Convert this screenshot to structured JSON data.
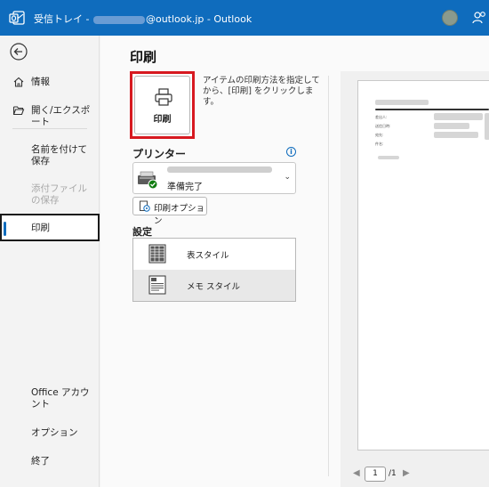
{
  "titlebar": {
    "prefix": "受信トレイ - ",
    "suffix": "@outlook.jp  -  Outlook"
  },
  "sidebar": {
    "items": [
      {
        "label": "情報"
      },
      {
        "label": "開く/エクスポート"
      },
      {
        "label": "名前を付けて保存"
      },
      {
        "label": "添付ファイルの保存"
      },
      {
        "label": "印刷"
      },
      {
        "label": "Office アカウント"
      },
      {
        "label": "オプション"
      },
      {
        "label": "終了"
      }
    ]
  },
  "main": {
    "heading": "印刷",
    "print_button_label": "印刷",
    "print_description": "アイテムの印刷方法を指定してから、[印刷] をクリックします。",
    "printer_label": "プリンター",
    "printer_status": "準備完了",
    "print_options_label": "印刷オプション",
    "settings_label": "設定",
    "styles": [
      {
        "label": "表スタイル"
      },
      {
        "label": "メモ スタイル"
      }
    ]
  },
  "preview": {
    "labels": [
      "差出人:",
      "送信日時:",
      "宛先:",
      "件名:"
    ],
    "page_current": "1",
    "page_total": "/1"
  },
  "colors": {
    "accent": "#0f6cbd",
    "highlight_border": "#d71920"
  }
}
